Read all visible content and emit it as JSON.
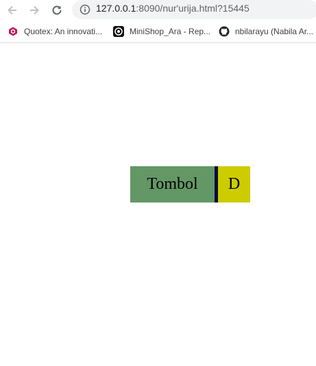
{
  "browser": {
    "url_host": "127.0.0.1",
    "url_rest": ":8090/nur'urija.html?15445",
    "icons": {
      "back": "arrow-left-icon",
      "forward": "arrow-right-icon",
      "reload": "reload-icon",
      "info": "info-icon"
    }
  },
  "bookmarks": [
    {
      "label": "Quotex: An innovati...",
      "icon": "quotex-icon"
    },
    {
      "label": "MiniShop_Ara - Rep...",
      "icon": "minishop-icon"
    },
    {
      "label": "nbilarayu (Nabila Ar...",
      "icon": "github-icon"
    }
  ],
  "page": {
    "button_label": "Tombol",
    "side_label": "D",
    "colors": {
      "button_bg": "#639866",
      "button_border": "#0b0b3a",
      "side_bg": "#cccc00"
    }
  }
}
